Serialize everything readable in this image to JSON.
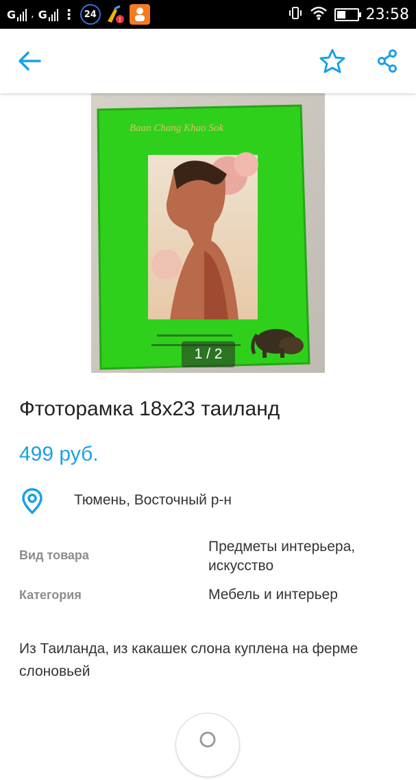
{
  "status_bar": {
    "sim1_label": "G",
    "sim2_label": "G",
    "notification_count": "24",
    "time": "23:58"
  },
  "toolbar": {
    "back_icon": "arrow-left-icon",
    "favorite_icon": "star-outline-icon",
    "share_icon": "share-icon",
    "accent_color": "#1aa0e6"
  },
  "gallery": {
    "counter": "1 / 2",
    "frame_caption": "Baan Chang Khao Sok"
  },
  "listing": {
    "title": "Фтоторамка 18х23 таиланд",
    "price": "499 руб.",
    "location": "Тюмень, Восточный р-н",
    "params": [
      {
        "label": "Вид товара",
        "value": "Предметы интерьера, искусство"
      },
      {
        "label": "Категория",
        "value": "Мебель и интерьер"
      }
    ],
    "description": "Из Таиланда, из какашек слона куплена на ферме слоновьей"
  }
}
